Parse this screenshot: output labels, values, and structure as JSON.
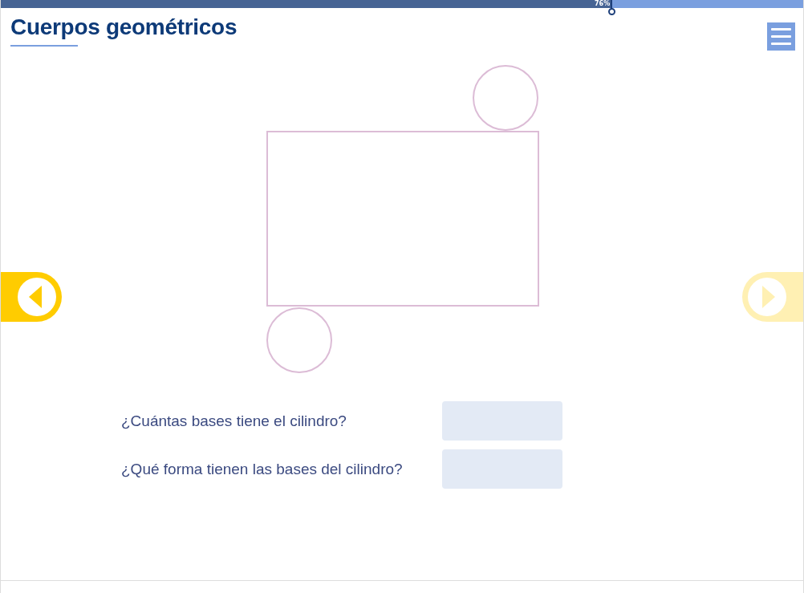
{
  "progress": {
    "level": 0.76,
    "label": "76%"
  },
  "header": {
    "title": "Cuerpos geométricos"
  },
  "navigation": {
    "previous": {
      "disabled": false
    },
    "next": {
      "disabled": true
    }
  },
  "questions": [
    {
      "text": "¿Cuántas bases tiene el cilindro?"
    },
    {
      "text": "¿Qué forma tienen las bases del cilindro?"
    }
  ]
}
